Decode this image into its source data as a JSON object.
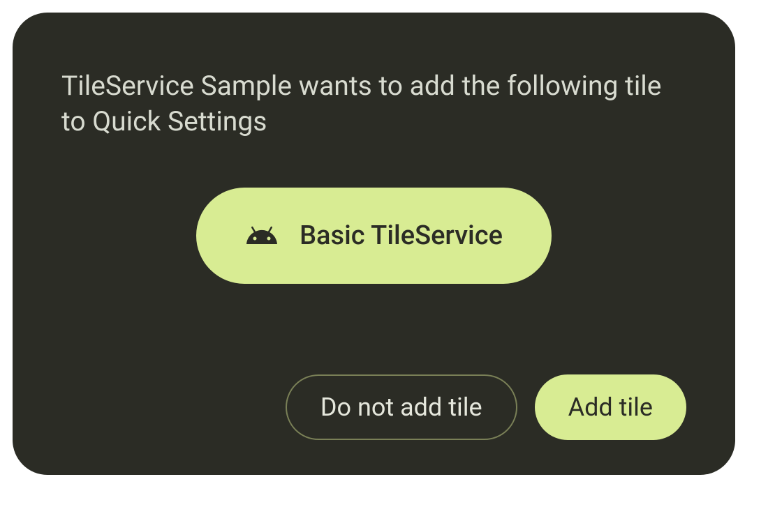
{
  "dialog": {
    "message": "TileService Sample wants to add the following tile to Quick Settings",
    "tile": {
      "icon": "android-icon",
      "label": "Basic TileService"
    },
    "buttons": {
      "decline": "Do not add tile",
      "accept": "Add tile"
    }
  },
  "colors": {
    "dialog_bg": "#2b2c25",
    "accent": "#d8ec93",
    "text_light": "#d8dbd0",
    "text_dark": "#2b2c25",
    "outline": "#7a8057"
  }
}
